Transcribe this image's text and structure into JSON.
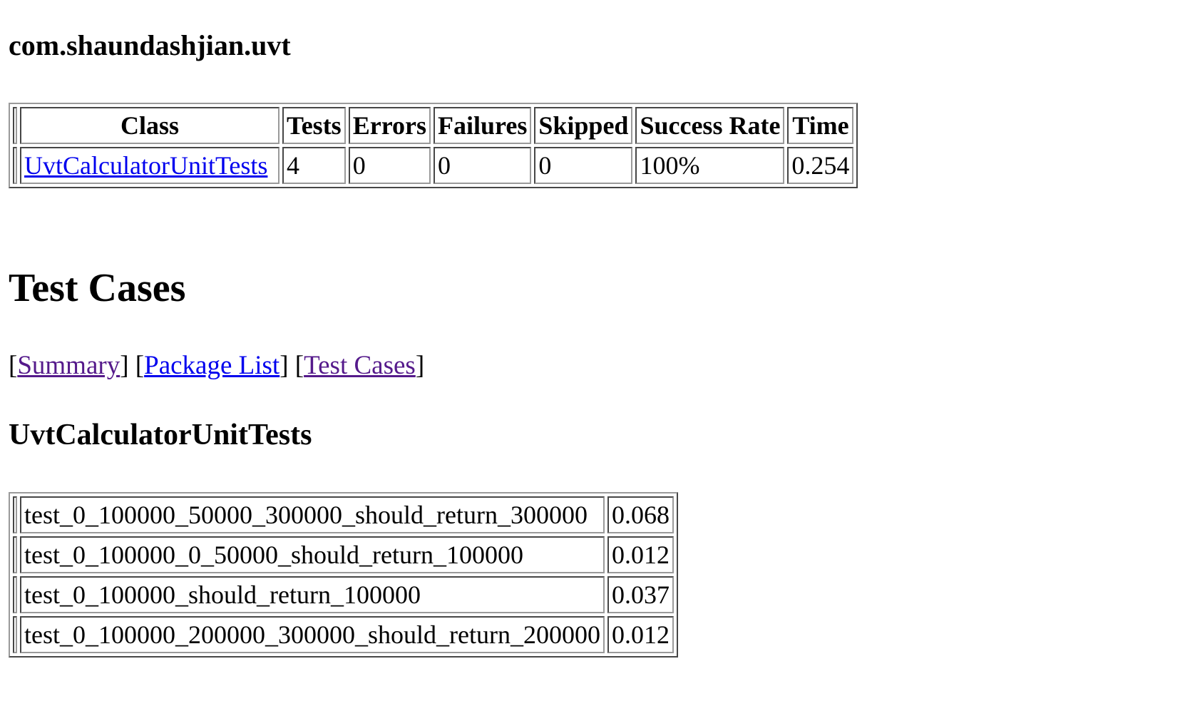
{
  "package": {
    "title": "com.shaundashjian.uvt"
  },
  "summary_table": {
    "headers": [
      "Class",
      "Tests",
      "Errors",
      "Failures",
      "Skipped",
      "Success Rate",
      "Time"
    ],
    "rows": [
      {
        "class": "UvtCalculatorUnitTests",
        "tests": "4",
        "errors": "0",
        "failures": "0",
        "skipped": "0",
        "success_rate": "100%",
        "time": "0.254"
      }
    ]
  },
  "test_cases_section": {
    "title": "Test Cases",
    "nav": {
      "summary": "Summary",
      "package_list": "Package List",
      "test_cases": "Test Cases"
    },
    "class_title": "UvtCalculatorUnitTests",
    "cases": [
      {
        "name": "test_0_100000_50000_300000_should_return_300000",
        "time": "0.068"
      },
      {
        "name": "test_0_100000_0_50000_should_return_100000",
        "time": "0.012"
      },
      {
        "name": "test_0_100000_should_return_100000",
        "time": "0.037"
      },
      {
        "name": "test_0_100000_200000_300000_should_return_200000",
        "time": "0.012"
      }
    ]
  },
  "colors": {
    "link": "#0000ee",
    "visited_link": "#551a8b",
    "border": "#9a9a9a"
  }
}
